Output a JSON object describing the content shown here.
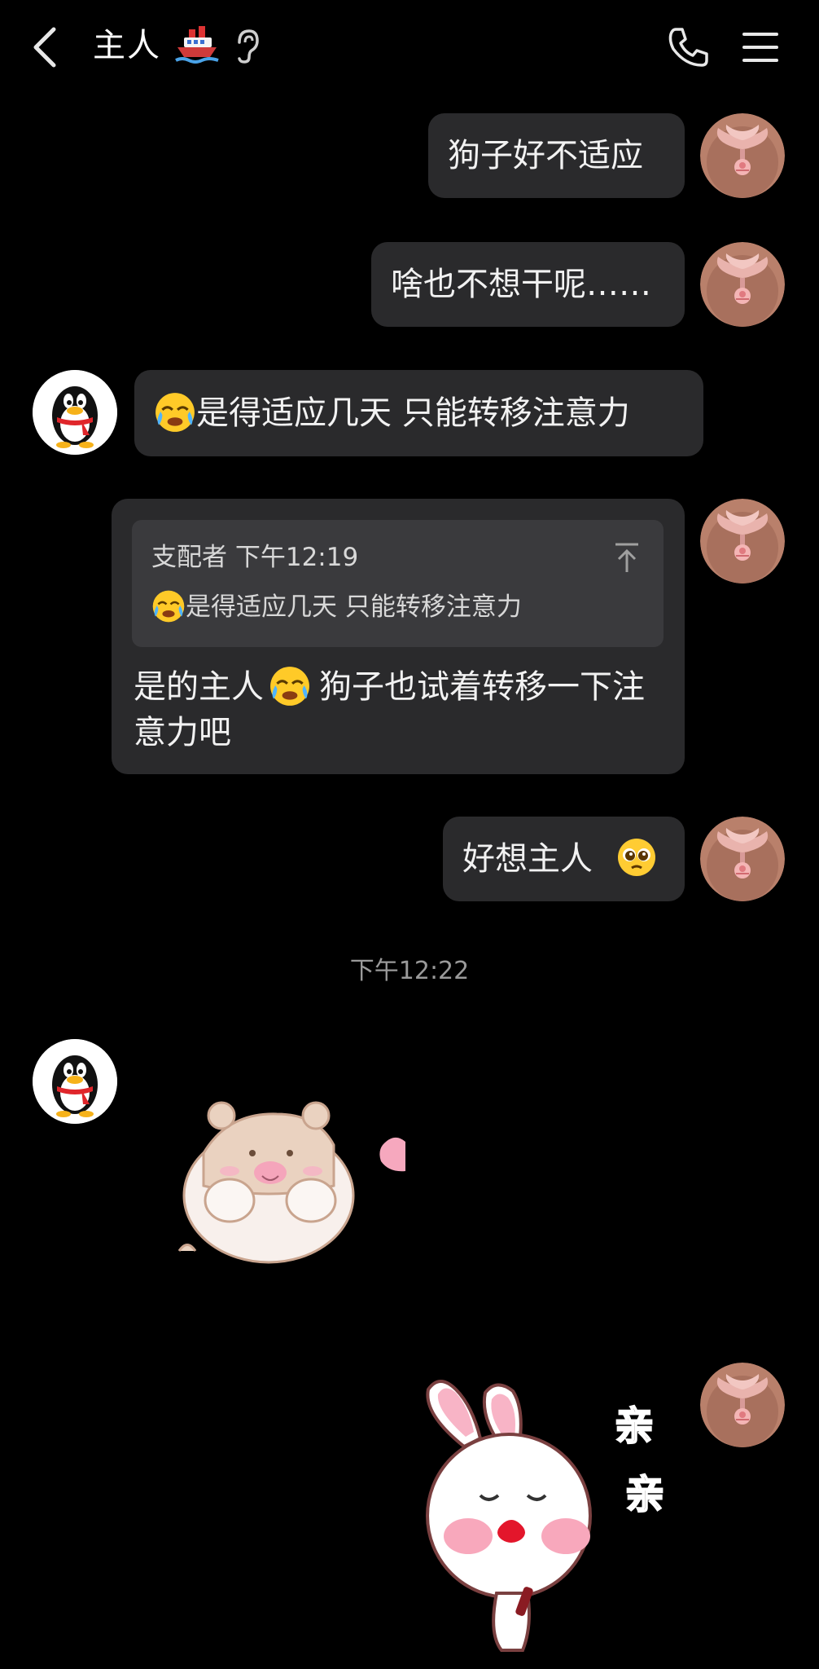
{
  "header": {
    "title": "主人",
    "icons": [
      "back-icon",
      "ship-icon",
      "ear-icon",
      "phone-icon",
      "menu-icon"
    ]
  },
  "messages": {
    "m1": "狗子好不适应",
    "m2": "啥也不想干呢……",
    "m3": "是得适应几天 只能转移注意力",
    "m4_quote_meta": "支配者 下午12:19",
    "m4_quote_text": "是得适应几天 只能转移注意力",
    "m4_reply_a": "是的主人",
    "m4_reply_b": "狗子也试着转移一下注意力吧",
    "m5": "好想主人",
    "timestamp": "下午12:22"
  },
  "stickers": {
    "kiss_text_1": "亲",
    "kiss_text_2": "亲"
  },
  "colors": {
    "background": "#000000",
    "bubble": "#2a2a2c",
    "quote_box": "#3a3a3d",
    "timestamp": "#9a9a9a"
  }
}
